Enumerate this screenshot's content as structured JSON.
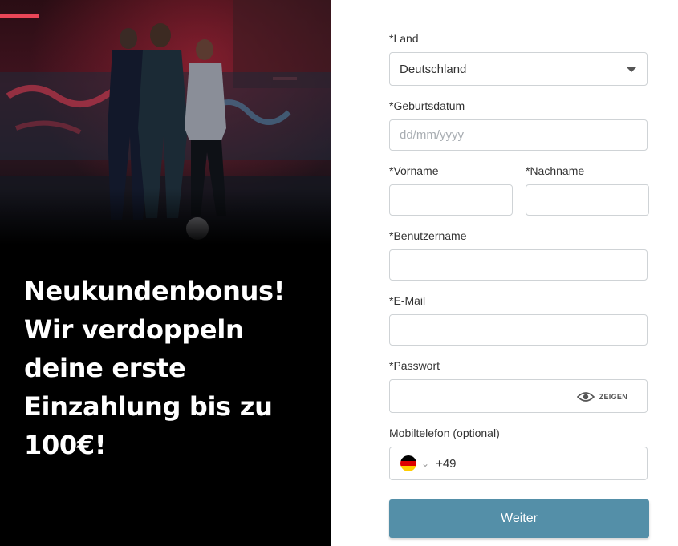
{
  "promo": {
    "headline_lines": [
      "Neukundenbonus!",
      "Wir verdoppeln",
      "deine erste",
      "Einzahlung bis zu",
      "100€!"
    ]
  },
  "form": {
    "country": {
      "label": "*Land",
      "value": "Deutschland"
    },
    "birthdate": {
      "label": "*Geburtsdatum",
      "placeholder": "dd/mm/yyyy"
    },
    "firstname": {
      "label": "*Vorname",
      "value": ""
    },
    "lastname": {
      "label": "*Nachname",
      "value": ""
    },
    "username": {
      "label": "*Benutzername",
      "value": ""
    },
    "email": {
      "label": "*E-Mail",
      "value": ""
    },
    "password": {
      "label": "*Passwort",
      "value": "",
      "toggle_label": "ZEIGEN"
    },
    "phone": {
      "label": "Mobiltelefon (optional)",
      "dial_code": "+49",
      "flag": "germany-flag"
    },
    "submit_label": "Weiter"
  },
  "colors": {
    "submit_bg": "#548fa8",
    "promo_bg": "#000000",
    "field_border": "#cfd3d6"
  }
}
